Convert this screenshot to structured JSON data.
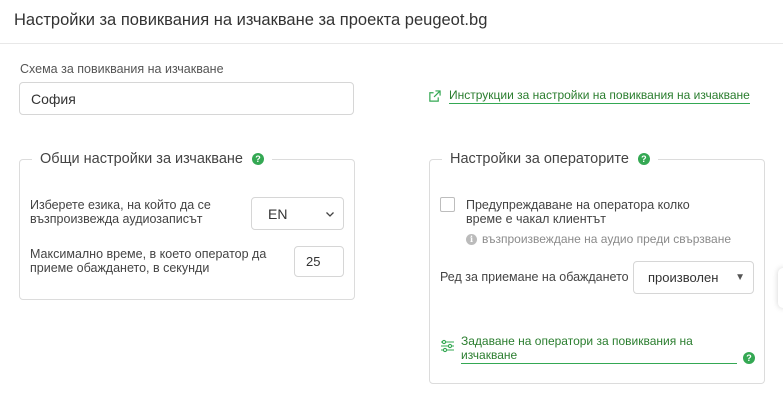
{
  "header": {
    "title": "Настройки за повиквания на изчакване за проекта peugeot.bg"
  },
  "scheme": {
    "label": "Схема за повиквания на изчакване",
    "value": "София"
  },
  "instructions_link": {
    "label": "Инструкции за настройки на повиквания на изчакване",
    "icon": "external-link-icon"
  },
  "general_panel": {
    "title": "Общи настройки за изчакване",
    "help": "?",
    "language": {
      "label": "Изберете езика, на който да се възпроизвежда аудиозаписът",
      "value": "EN"
    },
    "max_time": {
      "label": "Максимално време, в което оператор да приеме обаждането, в секунди",
      "value": "25"
    }
  },
  "operators_panel": {
    "title": "Настройки за операторите",
    "help": "?",
    "warn_checkbox": {
      "label": "Предупреждаване на оператора колко време е чакал клиентът",
      "checked": false
    },
    "hint": {
      "icon": "i",
      "text": "възпроизвеждане на аудио преди свързване"
    },
    "order": {
      "label": "Ред за приемане на обаждането",
      "value": "произволен"
    },
    "assign_link": {
      "label": "Задаване на оператори за повиквания на изчакване",
      "help": "?"
    }
  },
  "colors": {
    "accent": "#34a853",
    "link": "#2a7d2e",
    "border": "#dcdcdc"
  }
}
